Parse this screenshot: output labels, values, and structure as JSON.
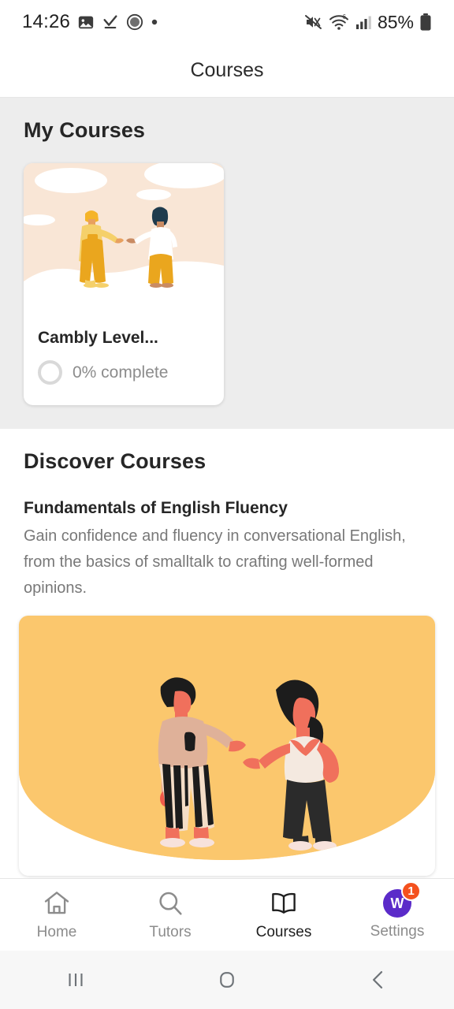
{
  "status_bar": {
    "time": "14:26",
    "battery_text": "85%",
    "left_icons": [
      "image-icon",
      "download-check-icon",
      "camera-circle-icon",
      "dot-icon"
    ],
    "right_icons": [
      "mute-icon",
      "wifi-6-icon",
      "signal-bars-icon",
      "battery-icon"
    ]
  },
  "app_bar": {
    "title": "Courses"
  },
  "my_courses": {
    "heading": "My Courses",
    "cards": [
      {
        "title": "Cambly Level...",
        "progress_text": "0% complete",
        "progress_pct": 0
      }
    ]
  },
  "discover": {
    "heading": "Discover Courses",
    "course": {
      "title": "Fundamentals of English Fluency",
      "description": "Gain confidence and fluency in conversational English, from the basics of smalltalk to crafting well-formed opinions."
    }
  },
  "bottom_nav": {
    "items": [
      {
        "label": "Home",
        "icon": "home-icon",
        "active": false
      },
      {
        "label": "Tutors",
        "icon": "search-icon",
        "active": false
      },
      {
        "label": "Courses",
        "icon": "book-icon",
        "active": true
      },
      {
        "label": "Settings",
        "icon": "avatar-icon",
        "avatar_initial": "W",
        "badge": "1",
        "active": false
      }
    ]
  },
  "android_nav": {
    "recents": "recents-icon",
    "home": "home-square-icon",
    "back": "back-chevron-icon"
  },
  "colors": {
    "section_bg": "#ededed",
    "promo_yellow": "#fbc76d",
    "card_art_bg": "#f9e6d6",
    "avatar_purple": "#5b2bc9",
    "badge_orange": "#f4511e"
  }
}
